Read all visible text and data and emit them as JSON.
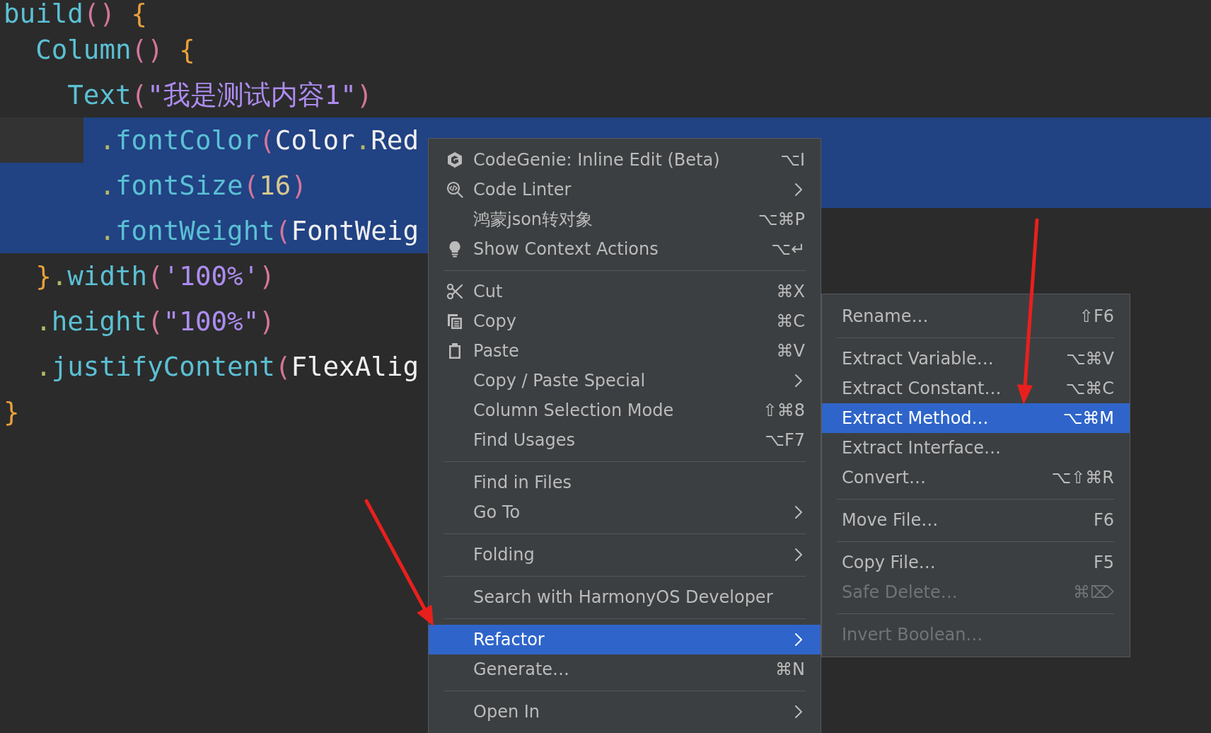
{
  "editor": {
    "lines": [
      {
        "tokens": [
          {
            "kind": "fn",
            "text": "build"
          },
          {
            "kind": "paren",
            "text": "()"
          },
          {
            "kind": "brace",
            "text": " {"
          }
        ],
        "selected": false,
        "children": [
          {
            "tokens": [
              {
                "kind": "fn",
                "text": "Column"
              },
              {
                "kind": "paren",
                "text": "()"
              },
              {
                "kind": "brace",
                "text": " {"
              }
            ],
            "selected": false,
            "children": [
              {
                "tokens": [
                  {
                    "kind": "fn",
                    "text": "Text"
                  },
                  {
                    "kind": "paren",
                    "text": "("
                  },
                  {
                    "kind": "str",
                    "text": "\"我是测试内容1\""
                  },
                  {
                    "kind": "paren",
                    "text": ")"
                  }
                ],
                "selected": false,
                "children": [
                  {
                    "tokens": [
                      {
                        "kind": "dot",
                        "text": "."
                      },
                      {
                        "kind": "fn",
                        "text": "fontColor"
                      },
                      {
                        "kind": "paren",
                        "text": "("
                      },
                      {
                        "kind": "ident",
                        "text": "Color"
                      },
                      {
                        "kind": "dot",
                        "text": "."
                      },
                      {
                        "kind": "ident",
                        "text": "Red"
                      }
                    ],
                    "selected": true
                  },
                  {
                    "tokens": [
                      {
                        "kind": "dot",
                        "text": "."
                      },
                      {
                        "kind": "fn",
                        "text": "fontSize"
                      },
                      {
                        "kind": "paren",
                        "text": "("
                      },
                      {
                        "kind": "num",
                        "text": "16"
                      },
                      {
                        "kind": "paren",
                        "text": ")"
                      }
                    ],
                    "selected": true
                  },
                  {
                    "tokens": [
                      {
                        "kind": "dot",
                        "text": "."
                      },
                      {
                        "kind": "fn",
                        "text": "fontWeight"
                      },
                      {
                        "kind": "paren",
                        "text": "("
                      },
                      {
                        "kind": "ident",
                        "text": "FontWeig"
                      }
                    ],
                    "selected": true
                  }
                ]
              }
            ]
          },
          {
            "tokens": [
              {
                "kind": "brace",
                "text": "}"
              },
              {
                "kind": "dot",
                "text": "."
              },
              {
                "kind": "fn",
                "text": "width"
              },
              {
                "kind": "paren",
                "text": "("
              },
              {
                "kind": "str",
                "text": "'100%'"
              },
              {
                "kind": "paren",
                "text": ")"
              }
            ],
            "selected": false
          },
          {
            "tokens": [
              {
                "kind": "dot",
                "text": "."
              },
              {
                "kind": "fn",
                "text": "height"
              },
              {
                "kind": "paren",
                "text": "("
              },
              {
                "kind": "str",
                "text": "\"100%\""
              },
              {
                "kind": "paren",
                "text": ")"
              }
            ],
            "selected": false
          },
          {
            "tokens": [
              {
                "kind": "dot",
                "text": "."
              },
              {
                "kind": "fn",
                "text": "justifyContent"
              },
              {
                "kind": "paren",
                "text": "("
              },
              {
                "kind": "ident",
                "text": "FlexAlig"
              }
            ],
            "selected": false
          }
        ]
      },
      {
        "tokens": [
          {
            "kind": "brace",
            "text": "}"
          }
        ],
        "selected": false
      }
    ]
  },
  "context_menu": {
    "groups": [
      {
        "items": [
          {
            "label": "CodeGenie: Inline Edit (Beta)",
            "shortcut": "⌥I",
            "submenu": false,
            "selected": false
          },
          {
            "label": "Code Linter",
            "submenu": true,
            "selected": false
          },
          {
            "label": "鸿蒙json转对象",
            "shortcut": "⌥⌘P",
            "submenu": false,
            "selected": false
          },
          {
            "label": "Show Context Actions",
            "shortcut": "⌥↵",
            "submenu": false,
            "selected": false
          }
        ]
      },
      {
        "items": [
          {
            "label": "Cut",
            "shortcut": "⌘X",
            "submenu": false,
            "selected": false
          },
          {
            "label": "Copy",
            "shortcut": "⌘C",
            "submenu": false,
            "selected": false
          },
          {
            "label": "Paste",
            "shortcut": "⌘V",
            "submenu": false,
            "selected": false
          },
          {
            "label": "Copy / Paste Special",
            "submenu": true,
            "selected": false
          },
          {
            "label": "Column Selection Mode",
            "shortcut": "⇧⌘8",
            "submenu": false,
            "selected": false
          },
          {
            "label": "Find Usages",
            "shortcut": "⌥F7",
            "submenu": false,
            "selected": false
          }
        ]
      },
      {
        "items": [
          {
            "label": "Find in Files",
            "submenu": false,
            "selected": false
          },
          {
            "label": "Go To",
            "submenu": true,
            "selected": false
          }
        ]
      },
      {
        "items": [
          {
            "label": "Folding",
            "submenu": true,
            "selected": false
          }
        ]
      },
      {
        "items": [
          {
            "label": "Search with HarmonyOS Developer",
            "submenu": false,
            "selected": false
          }
        ]
      },
      {
        "items": [
          {
            "label": "Refactor",
            "submenu": true,
            "selected": true
          },
          {
            "label": "Generate…",
            "shortcut": "⌘N",
            "submenu": false,
            "selected": false
          }
        ]
      },
      {
        "items": [
          {
            "label": "Open In",
            "submenu": true,
            "selected": false
          }
        ]
      }
    ]
  },
  "refactor_submenu": {
    "groups": [
      {
        "items": [
          {
            "label": "Rename…",
            "shortcut": "⇧F6",
            "selected": false,
            "disabled": false
          }
        ]
      },
      {
        "items": [
          {
            "label": "Extract Variable…",
            "shortcut": "⌥⌘V",
            "selected": false,
            "disabled": false
          },
          {
            "label": "Extract Constant…",
            "shortcut": "⌥⌘C",
            "selected": false,
            "disabled": false
          },
          {
            "label": "Extract Method…",
            "shortcut": "⌥⌘M",
            "selected": true,
            "disabled": false
          },
          {
            "label": "Extract Interface…",
            "selected": false,
            "disabled": false
          },
          {
            "label": "Convert…",
            "shortcut": "⌥⇧⌘R",
            "selected": false,
            "disabled": false
          }
        ]
      },
      {
        "items": [
          {
            "label": "Move File…",
            "shortcut": "F6",
            "selected": false,
            "disabled": false
          }
        ]
      },
      {
        "items": [
          {
            "label": "Copy File…",
            "shortcut": "F5",
            "selected": false,
            "disabled": false
          },
          {
            "label": "Safe Delete…",
            "shortcut": "⌘⌦",
            "selected": false,
            "disabled": true
          }
        ]
      },
      {
        "items": [
          {
            "label": "Invert Boolean…",
            "selected": false,
            "disabled": true
          }
        ]
      }
    ]
  }
}
